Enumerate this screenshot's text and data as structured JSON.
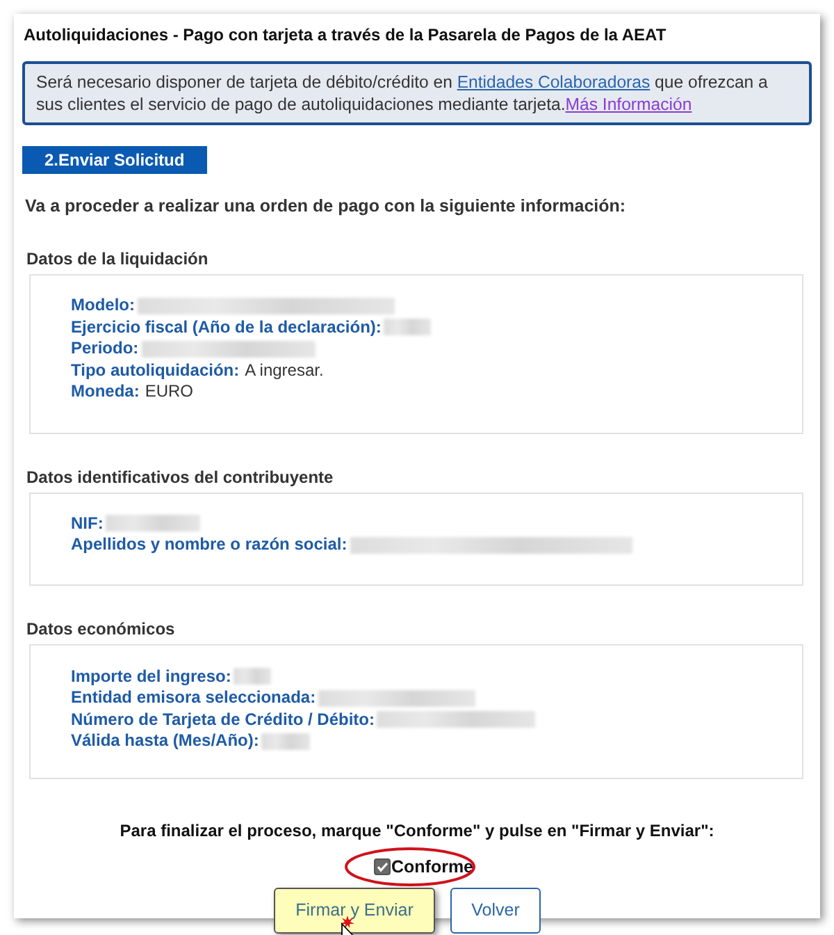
{
  "window": {
    "title": "Autoliquidaciones - Pago con tarjeta a través de la Pasarela de Pagos de la AEAT"
  },
  "notice": {
    "text": "Será necesario disponer de tarjeta de débito/crédito en ",
    "link": "Entidades Colaboradoras",
    "text_2": " que ofrezcan a sus clientes el servicio de pago de autoliquidaciones mediante tarjeta.",
    "link_2": "Más Información"
  },
  "step": {
    "label": "2.Enviar Solicitud"
  },
  "intro": "Va a proceder a realizar una orden de pago con la siguiente información:",
  "sections": [
    {
      "title": "Datos de la liquidación",
      "fields": [
        {
          "label": "Modelo:",
          "kind": "redacted"
        },
        {
          "label": "Ejercicio fiscal (Año de la declaración):",
          "kind": "redacted"
        },
        {
          "label": "Periodo:",
          "kind": "redacted"
        },
        {
          "label": "Tipo autoliquidación:",
          "kind": "text",
          "value": "A ingresar."
        },
        {
          "label": "Moneda:",
          "kind": "text",
          "value": "EURO"
        }
      ]
    },
    {
      "title": "Datos identificativos del contribuyente",
      "fields": [
        {
          "label": "NIF:",
          "kind": "redacted"
        },
        {
          "label": "Apellidos y nombre o razón social:",
          "kind": "redacted"
        }
      ]
    },
    {
      "title": "Datos económicos",
      "fields": [
        {
          "label": "Importe del ingreso:",
          "kind": "redacted"
        },
        {
          "label": "Entidad emisora seleccionada:",
          "kind": "redacted"
        },
        {
          "label": "Número de Tarjeta de Crédito / Débito:",
          "kind": "redacted"
        },
        {
          "label": "Válida hasta (Mes/Año):",
          "kind": "redacted"
        }
      ]
    }
  ],
  "instruction": "Para finalizar el proceso, marque \"Conforme\" y pulse en \"Firmar y Enviar\":",
  "agree": {
    "label": "Conforme",
    "checked": true
  },
  "buttons": [
    {
      "label": "Firmar y Enviar",
      "kind": "primary"
    },
    {
      "label": "Volver",
      "kind": "secondary"
    }
  ]
}
